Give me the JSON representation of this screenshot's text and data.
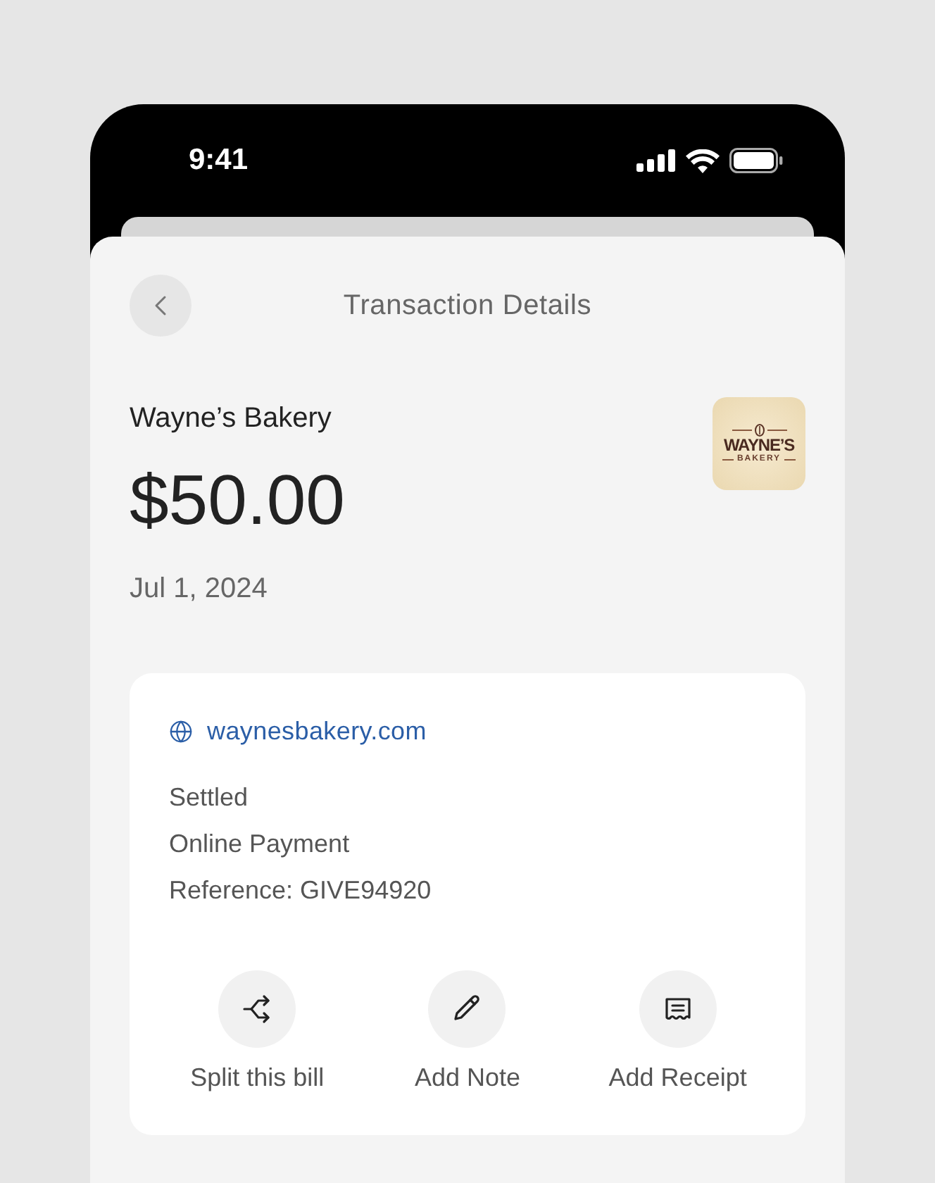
{
  "status_bar": {
    "time": "9:41"
  },
  "header": {
    "title": "Transaction Details"
  },
  "merchant": {
    "name": "Wayne’s Bakery",
    "amount": "$50.00",
    "date": "Jul 1, 2024",
    "logo": {
      "title": "WAYNE’S",
      "subtitle": "BAKERY"
    }
  },
  "details": {
    "website": "waynesbakery.com",
    "lines": [
      "Settled",
      "Online Payment",
      "Reference: GIVE94920"
    ]
  },
  "actions": [
    {
      "kind": "split",
      "label": "Split this bill"
    },
    {
      "kind": "note",
      "label": "Add Note"
    },
    {
      "kind": "receipt",
      "label": "Add Receipt"
    }
  ]
}
